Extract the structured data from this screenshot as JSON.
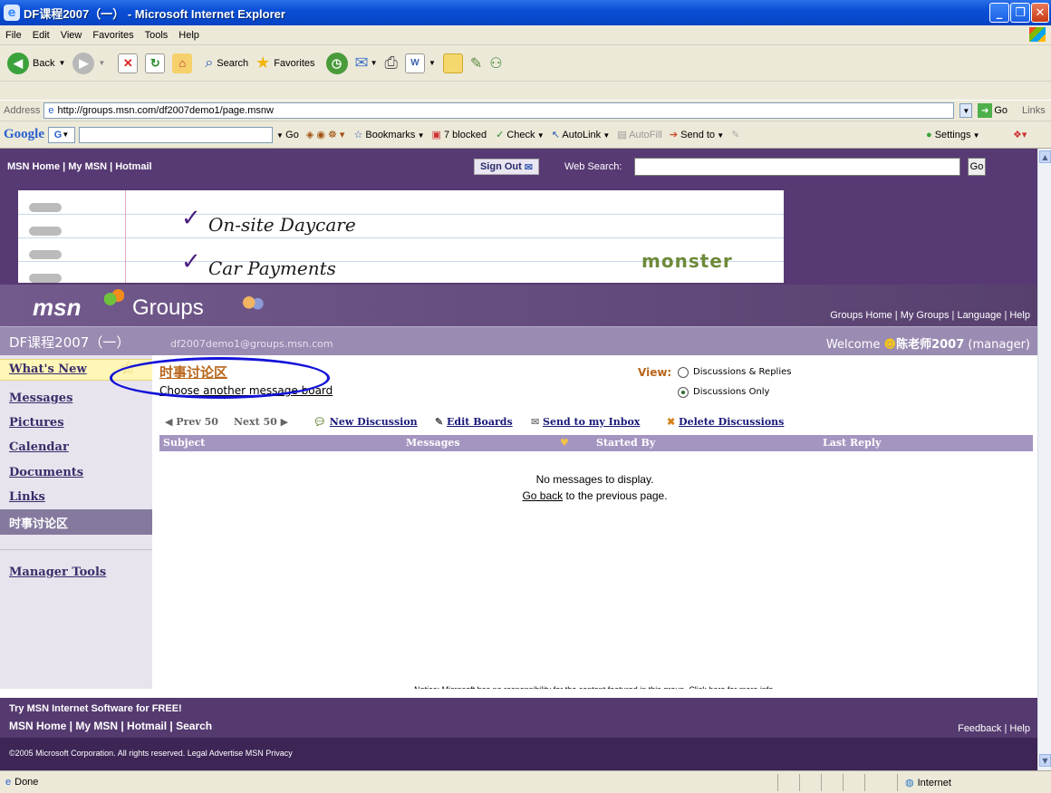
{
  "window": {
    "title": "DF课程2007（一） - Microsoft Internet Explorer",
    "min": "_",
    "max": "❐",
    "close": "✕"
  },
  "menu": [
    "File",
    "Edit",
    "View",
    "Favorites",
    "Tools",
    "Help"
  ],
  "toolbar": {
    "back": "Back",
    "search": "Search",
    "favorites": "Favorites"
  },
  "address": {
    "label": "Address",
    "url": "http://groups.msn.com/df2007demo1/page.msnw",
    "go": "Go",
    "links": "Links"
  },
  "googlebar": {
    "logo": "Google",
    "g": "G",
    "go": "Go",
    "bookmarks": "Bookmarks",
    "blocked": "7 blocked",
    "check": "Check",
    "autolink": "AutoLink",
    "autofill": "AutoFill",
    "sendto": "Send to",
    "settings": "Settings"
  },
  "msnheader": {
    "links": "MSN Home | My MSN | Hotmail",
    "signout": "Sign Out",
    "websearch": "Web Search:",
    "go": "Go"
  },
  "ad": {
    "line1": "On-site Daycare",
    "line2": "Car Payments",
    "brand": "monster"
  },
  "groups": {
    "logo": "msn",
    "word": "Groups",
    "links": "Groups Home | My Groups | Language | Help"
  },
  "group": {
    "name": "DF课程2007（一）",
    "email": "df2007demo1@groups.msn.com",
    "welcome_prefix": "Welcome ",
    "user": "陈老师2007",
    "role": " (manager)"
  },
  "nav": {
    "whatsnew": "What's New",
    "messages": "Messages",
    "pictures": "Pictures",
    "calendar": "Calendar",
    "documents": "Documents",
    "links": "Links",
    "current": "时事讨论区",
    "manager": "Manager Tools"
  },
  "board": {
    "title": "时事讨论区",
    "choose": "Choose another message board",
    "view_label": "View:",
    "opt1": "Discussions & Replies",
    "opt2": "Discussions Only",
    "prev": "Prev 50",
    "next": "Next 50",
    "newdisc": "New Discussion",
    "editboards": "Edit Boards",
    "sendinbox": "Send to my Inbox",
    "deletedisc": "Delete Discussions",
    "columns": [
      "Subject",
      "Messages",
      "Started By",
      "Last Reply"
    ],
    "nomsg": "No messages to display.",
    "goback_link": "Go back",
    "goback_rest": " to the previous page.",
    "notice": "Notice: Microsoft has no responsibility for the content featured in this group.",
    "notice_link": "Click here for more info."
  },
  "footer": {
    "try": "Try MSN Internet Software for FREE!",
    "links": "MSN Home | My MSN | Hotmail | Search",
    "right": "Feedback | Help",
    "copy": "©2005 Microsoft Corporation. All rights reserved.  Legal   Advertise   MSN Privacy"
  },
  "status": {
    "done": "Done",
    "zone": "Internet"
  }
}
